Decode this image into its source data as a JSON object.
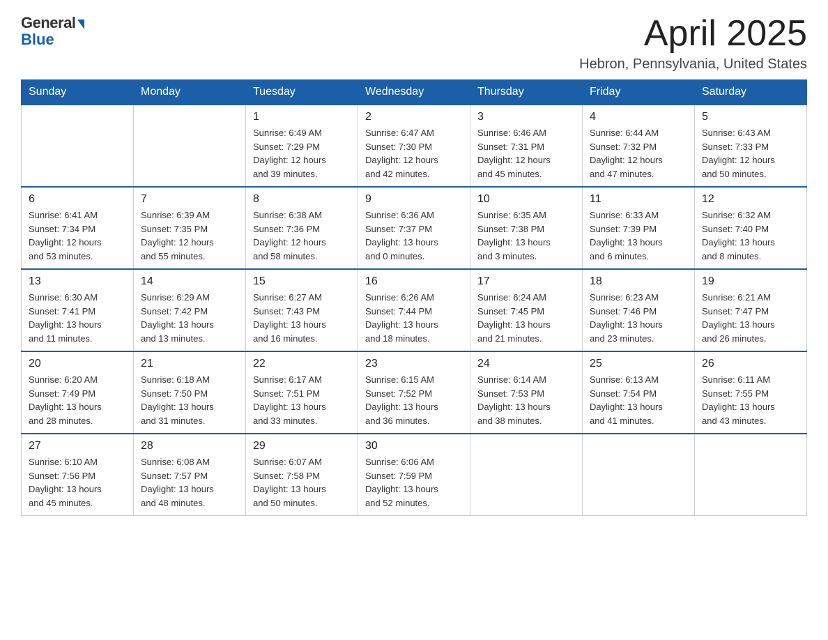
{
  "header": {
    "logo_general": "General",
    "logo_blue": "Blue",
    "main_title": "April 2025",
    "sub_title": "Hebron, Pennsylvania, United States"
  },
  "calendar": {
    "days_of_week": [
      "Sunday",
      "Monday",
      "Tuesday",
      "Wednesday",
      "Thursday",
      "Friday",
      "Saturday"
    ],
    "weeks": [
      [
        {
          "day": "",
          "info": ""
        },
        {
          "day": "",
          "info": ""
        },
        {
          "day": "1",
          "info": "Sunrise: 6:49 AM\nSunset: 7:29 PM\nDaylight: 12 hours\nand 39 minutes."
        },
        {
          "day": "2",
          "info": "Sunrise: 6:47 AM\nSunset: 7:30 PM\nDaylight: 12 hours\nand 42 minutes."
        },
        {
          "day": "3",
          "info": "Sunrise: 6:46 AM\nSunset: 7:31 PM\nDaylight: 12 hours\nand 45 minutes."
        },
        {
          "day": "4",
          "info": "Sunrise: 6:44 AM\nSunset: 7:32 PM\nDaylight: 12 hours\nand 47 minutes."
        },
        {
          "day": "5",
          "info": "Sunrise: 6:43 AM\nSunset: 7:33 PM\nDaylight: 12 hours\nand 50 minutes."
        }
      ],
      [
        {
          "day": "6",
          "info": "Sunrise: 6:41 AM\nSunset: 7:34 PM\nDaylight: 12 hours\nand 53 minutes."
        },
        {
          "day": "7",
          "info": "Sunrise: 6:39 AM\nSunset: 7:35 PM\nDaylight: 12 hours\nand 55 minutes."
        },
        {
          "day": "8",
          "info": "Sunrise: 6:38 AM\nSunset: 7:36 PM\nDaylight: 12 hours\nand 58 minutes."
        },
        {
          "day": "9",
          "info": "Sunrise: 6:36 AM\nSunset: 7:37 PM\nDaylight: 13 hours\nand 0 minutes."
        },
        {
          "day": "10",
          "info": "Sunrise: 6:35 AM\nSunset: 7:38 PM\nDaylight: 13 hours\nand 3 minutes."
        },
        {
          "day": "11",
          "info": "Sunrise: 6:33 AM\nSunset: 7:39 PM\nDaylight: 13 hours\nand 6 minutes."
        },
        {
          "day": "12",
          "info": "Sunrise: 6:32 AM\nSunset: 7:40 PM\nDaylight: 13 hours\nand 8 minutes."
        }
      ],
      [
        {
          "day": "13",
          "info": "Sunrise: 6:30 AM\nSunset: 7:41 PM\nDaylight: 13 hours\nand 11 minutes."
        },
        {
          "day": "14",
          "info": "Sunrise: 6:29 AM\nSunset: 7:42 PM\nDaylight: 13 hours\nand 13 minutes."
        },
        {
          "day": "15",
          "info": "Sunrise: 6:27 AM\nSunset: 7:43 PM\nDaylight: 13 hours\nand 16 minutes."
        },
        {
          "day": "16",
          "info": "Sunrise: 6:26 AM\nSunset: 7:44 PM\nDaylight: 13 hours\nand 18 minutes."
        },
        {
          "day": "17",
          "info": "Sunrise: 6:24 AM\nSunset: 7:45 PM\nDaylight: 13 hours\nand 21 minutes."
        },
        {
          "day": "18",
          "info": "Sunrise: 6:23 AM\nSunset: 7:46 PM\nDaylight: 13 hours\nand 23 minutes."
        },
        {
          "day": "19",
          "info": "Sunrise: 6:21 AM\nSunset: 7:47 PM\nDaylight: 13 hours\nand 26 minutes."
        }
      ],
      [
        {
          "day": "20",
          "info": "Sunrise: 6:20 AM\nSunset: 7:49 PM\nDaylight: 13 hours\nand 28 minutes."
        },
        {
          "day": "21",
          "info": "Sunrise: 6:18 AM\nSunset: 7:50 PM\nDaylight: 13 hours\nand 31 minutes."
        },
        {
          "day": "22",
          "info": "Sunrise: 6:17 AM\nSunset: 7:51 PM\nDaylight: 13 hours\nand 33 minutes."
        },
        {
          "day": "23",
          "info": "Sunrise: 6:15 AM\nSunset: 7:52 PM\nDaylight: 13 hours\nand 36 minutes."
        },
        {
          "day": "24",
          "info": "Sunrise: 6:14 AM\nSunset: 7:53 PM\nDaylight: 13 hours\nand 38 minutes."
        },
        {
          "day": "25",
          "info": "Sunrise: 6:13 AM\nSunset: 7:54 PM\nDaylight: 13 hours\nand 41 minutes."
        },
        {
          "day": "26",
          "info": "Sunrise: 6:11 AM\nSunset: 7:55 PM\nDaylight: 13 hours\nand 43 minutes."
        }
      ],
      [
        {
          "day": "27",
          "info": "Sunrise: 6:10 AM\nSunset: 7:56 PM\nDaylight: 13 hours\nand 45 minutes."
        },
        {
          "day": "28",
          "info": "Sunrise: 6:08 AM\nSunset: 7:57 PM\nDaylight: 13 hours\nand 48 minutes."
        },
        {
          "day": "29",
          "info": "Sunrise: 6:07 AM\nSunset: 7:58 PM\nDaylight: 13 hours\nand 50 minutes."
        },
        {
          "day": "30",
          "info": "Sunrise: 6:06 AM\nSunset: 7:59 PM\nDaylight: 13 hours\nand 52 minutes."
        },
        {
          "day": "",
          "info": ""
        },
        {
          "day": "",
          "info": ""
        },
        {
          "day": "",
          "info": ""
        }
      ]
    ]
  }
}
